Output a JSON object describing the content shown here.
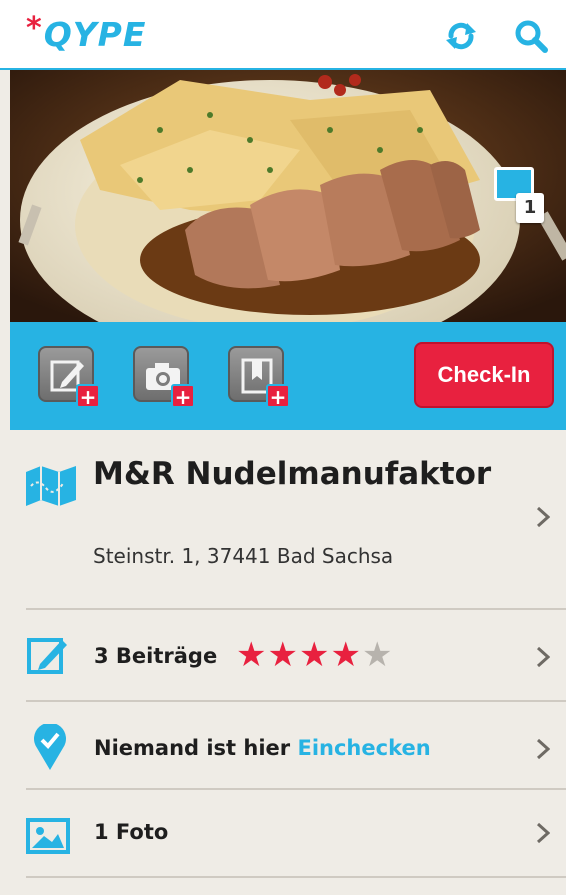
{
  "header": {
    "logo_star": "*",
    "logo_text": "QYPE",
    "icons": [
      "refresh-icon",
      "search-icon"
    ],
    "accent_color": "#27b3e3",
    "brand_red": "#e8213f"
  },
  "hero": {
    "photo_count": "1"
  },
  "actions": {
    "icons": [
      "write-review-icon",
      "add-photo-icon",
      "bookmark-icon"
    ],
    "plus_label": "+",
    "checkin_label": "Check-In"
  },
  "place": {
    "name": "M&R Nudelmanufaktor",
    "address": "Steinstr. 1, 37441 Bad Sachsa"
  },
  "rows": {
    "reviews": {
      "label": "3 Beiträge",
      "rating": 4,
      "max_rating": 5
    },
    "checkins": {
      "label": "Niemand ist hier",
      "link": "Einchecken"
    },
    "photos": {
      "label": "1 Foto"
    }
  }
}
